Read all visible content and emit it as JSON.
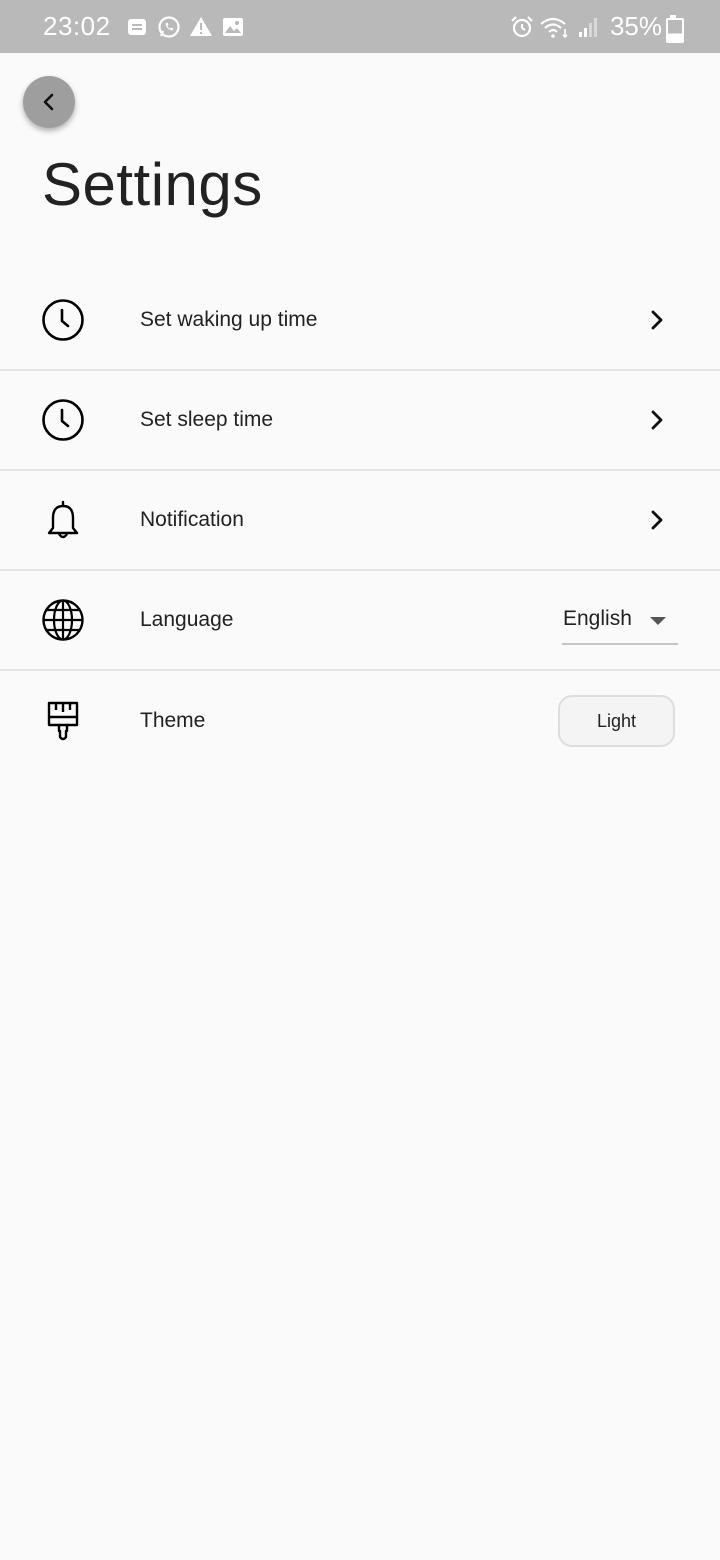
{
  "status_bar": {
    "time": "23:02",
    "battery": "35%",
    "left_icons": [
      "message-icon",
      "whatsapp-icon",
      "warning-icon",
      "image-icon"
    ],
    "right_icons": [
      "alarm-icon",
      "wifi-icon",
      "signal-icon",
      "battery-icon"
    ]
  },
  "header": {
    "title": "Settings"
  },
  "settings": {
    "items": [
      {
        "label": "Set waking up time",
        "icon": "clock-icon",
        "action": "chevron"
      },
      {
        "label": "Set sleep time",
        "icon": "clock-icon",
        "action": "chevron"
      },
      {
        "label": "Notification",
        "icon": "bell-icon",
        "action": "chevron"
      },
      {
        "label": "Language",
        "icon": "globe-icon",
        "action": "dropdown",
        "value": "English"
      },
      {
        "label": "Theme",
        "icon": "paint-brush-icon",
        "action": "button",
        "value": "Light"
      }
    ]
  },
  "colors": {
    "background": "#fafafa",
    "status_bar": "#b9b9b9",
    "back_button": "#9e9e9e",
    "divider": "#e4e4e4",
    "text": "#222222"
  }
}
